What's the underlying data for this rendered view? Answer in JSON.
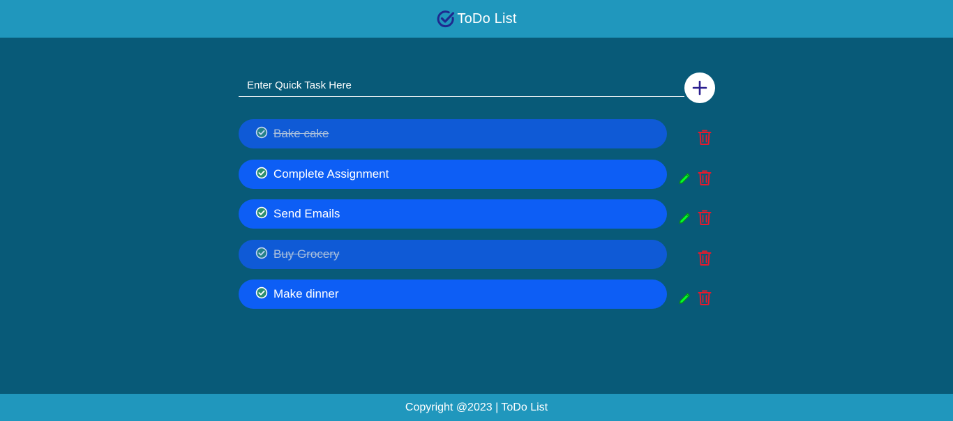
{
  "header": {
    "title": "ToDo List",
    "logo_icon": "check-circle-icon",
    "background_color": "#2097bd"
  },
  "quick_task": {
    "placeholder": "Enter Quick Task Here",
    "value": "",
    "add_icon": "plus-icon"
  },
  "tasks": [
    {
      "label": "Bake cake",
      "completed": true
    },
    {
      "label": "Complete Assignment",
      "completed": false
    },
    {
      "label": "Send Emails",
      "completed": false
    },
    {
      "label": "Buy Grocery",
      "completed": true
    },
    {
      "label": "Make dinner",
      "completed": false
    }
  ],
  "icons": {
    "check": "check-circle-icon",
    "edit": "pencil-icon",
    "delete": "trash-icon"
  },
  "colors": {
    "page_background": "#085a78",
    "task_background": "#0d5ef5",
    "edit_icon": "#00ff2a",
    "delete_icon": "#e8192c",
    "add_icon": "#2b1f8f"
  },
  "footer": {
    "text": "Copyright @2023 | ToDo List"
  }
}
